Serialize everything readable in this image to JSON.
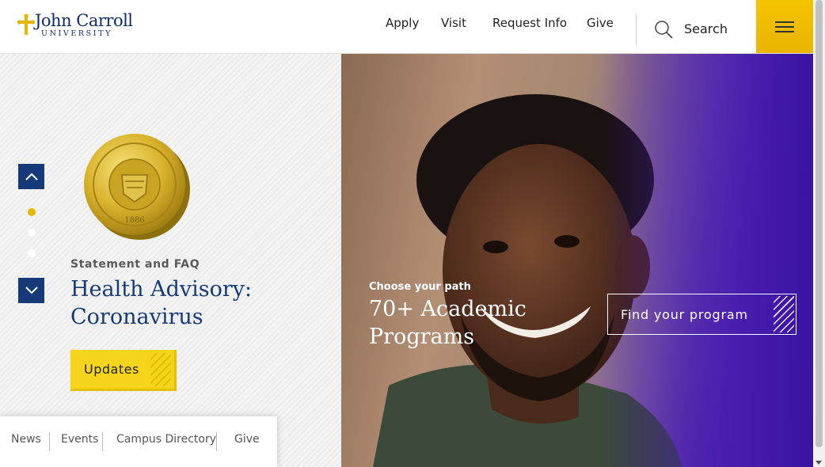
{
  "header": {
    "logo": {
      "name": "John Carroll",
      "sub": "UNIVERSITY"
    },
    "nav": [
      {
        "label": "Apply"
      },
      {
        "label": "Visit"
      },
      {
        "label": "Request Info"
      },
      {
        "label": "Give"
      }
    ],
    "search_label": "Search",
    "menu_icon": "hamburger-icon"
  },
  "slider": {
    "up_icon": "chevron-up-icon",
    "down_icon": "chevron-down-icon",
    "dots": [
      {
        "active": true
      },
      {
        "active": false
      },
      {
        "active": false
      }
    ],
    "seal_text": "UNIVERSITAS JOANNIS CARROLL 1886",
    "eyebrow": "Statement and FAQ",
    "headline": "Health Advisory: Coronavirus",
    "button_label": "Updates"
  },
  "utility_bar": {
    "links": [
      {
        "label": "News"
      },
      {
        "label": "Events"
      },
      {
        "label": "Campus Directory"
      },
      {
        "label": "Give"
      }
    ]
  },
  "hero": {
    "eyebrow": "Choose your path",
    "title": "70+ Academic Programs",
    "button_label": "Find your program"
  },
  "colors": {
    "brand_navy": "#163a78",
    "brand_gold": "#f5c400",
    "hero_purple": "#4a1fb0"
  }
}
